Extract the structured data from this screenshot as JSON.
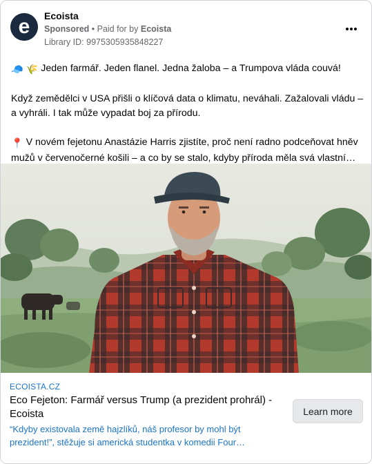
{
  "post": {
    "page_name": "Ecoista",
    "sponsored_label": "Sponsored",
    "paid_for_prefix": " • Paid for by ",
    "payer": "Ecoista",
    "library_id": "Library ID: 9975305935848227",
    "avatar_letter": "e",
    "more_icon": "more-horizontal-icon",
    "body": {
      "line1_emoji_a": "🧢",
      "line1_emoji_b": "🌾",
      "line1": "Jeden farmář. Jeden flanel. Jedna žaloba – a Trumpova vláda couvá!",
      "para2": "Když zemědělci v USA přišli o klíčová data o klimatu, neváhali. Zažalovali vládu – a vyhráli. I tak může vypadat boj za přírodu.",
      "para3_emoji": "📍",
      "para3": "V novém fejetonu Anastázie Harris zjistíte, proč není radno podceňovat hněv mužů v červenočerné košili – a co by se stalo, kdyby příroda měla svá vlastní…"
    },
    "link": {
      "domain": "ECOISTA.CZ",
      "title": "Eco Fejeton: Farmář versus Trump (a prezident prohrál) - Ecoista",
      "description": "“Kdyby existovala země hajzlíků, náš profesor by mohl být prezident!”, stěžuje si americká studentka v komedii Four…",
      "cta": "Learn more"
    }
  },
  "colors": {
    "link_blue": "#1a73c7",
    "shirt_red": "#b23a2c",
    "shirt_dark": "#2a2024",
    "sky": "#e3e6dc",
    "meadow": "#8fae7e"
  }
}
